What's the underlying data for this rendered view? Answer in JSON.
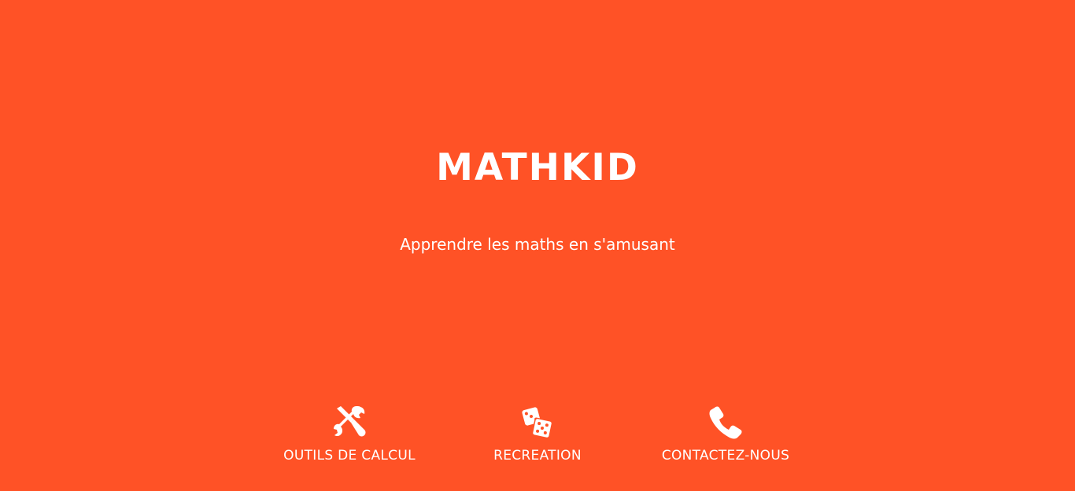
{
  "hero": {
    "title": "MATHKID",
    "subtitle": "Apprendre les maths en s'amusant"
  },
  "nav": {
    "items": [
      {
        "label": "OUTILS DE CALCUL",
        "icon": "tools-icon"
      },
      {
        "label": "RECREATION",
        "icon": "dice-icon"
      },
      {
        "label": "CONTACTEZ-NOUS",
        "icon": "phone-icon"
      }
    ]
  },
  "colors": {
    "background": "#FF5226",
    "text": "#FFFFFF"
  }
}
